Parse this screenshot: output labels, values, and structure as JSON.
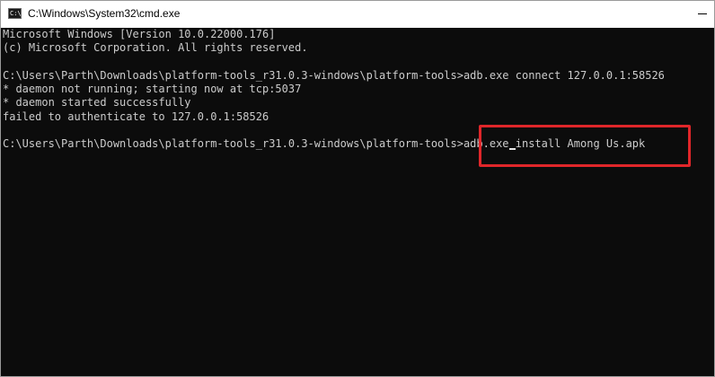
{
  "window": {
    "title": "C:\\Windows\\System32\\cmd.exe",
    "icon": "cmd-icon"
  },
  "console": {
    "lines": [
      "Microsoft Windows [Version 10.0.22000.176]",
      "(c) Microsoft Corporation. All rights reserved.",
      "",
      "C:\\Users\\Parth\\Downloads\\platform-tools_r31.0.3-windows\\platform-tools>adb.exe connect 127.0.0.1:58526",
      "* daemon not running; starting now at tcp:5037",
      "* daemon started successfully",
      "failed to authenticate to 127.0.0.1:58526",
      ""
    ],
    "prompt": "C:\\Users\\Parth\\Downloads\\platform-tools_r31.0.3-windows\\platform-tools>",
    "command_part1": "adb.exe",
    "command_part2": " install Among Us.apk"
  },
  "colors": {
    "console_bg": "#0c0c0c",
    "console_text": "#cccccc",
    "highlight": "#e0262a"
  }
}
